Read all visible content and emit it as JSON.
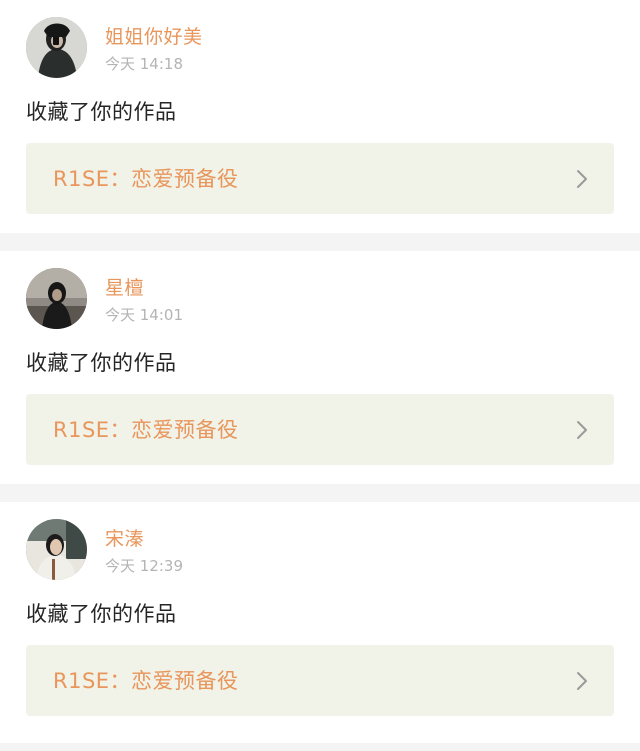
{
  "notifications": [
    {
      "username": "姐姐你好美",
      "time": "今天 14:18",
      "action": "收藏了你的作品",
      "work_title": "R1SE：恋爱预备役",
      "avatar_icon": "user-photo-avatar"
    },
    {
      "username": "星檀",
      "time": "今天 14:01",
      "action": "收藏了你的作品",
      "work_title": "R1SE：恋爱预备役",
      "avatar_icon": "user-photo-avatar"
    },
    {
      "username": "宋溱",
      "time": "今天 12:39",
      "action": "收藏了你的作品",
      "work_title": "R1SE：恋爱预备役",
      "avatar_icon": "user-photo-avatar"
    }
  ],
  "colors": {
    "accent": "#e8965c",
    "card_link_bg": "#f1f3e8",
    "divider_bg": "#f4f4f4",
    "timestamp": "#b4b4b4",
    "body_text": "#262626",
    "chevron": "#9a9a9a"
  }
}
